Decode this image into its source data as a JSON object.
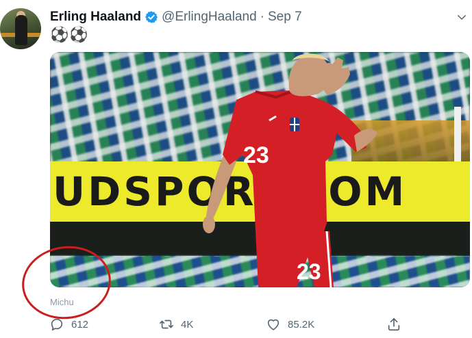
{
  "tweet": {
    "display_name": "Erling Haaland",
    "handle": "@ErlingHaaland",
    "separator": "·",
    "date": "Sep 7",
    "text": "⚽⚽",
    "more_icon": "chevron-down-icon"
  },
  "photo": {
    "banner_text": "UDSPORT.COM",
    "shirt_number": "23",
    "shorts_number": "23",
    "shirt_color": "#d41f26",
    "banner_color": "#ecea2a"
  },
  "annotation": {
    "watermark_text": "Michu",
    "circle_color": "#cc1d1d"
  },
  "actions": {
    "reply_count": "612",
    "retweet_count": "4K",
    "like_count": "85.2K"
  },
  "colors": {
    "verified": "#1d9bf0",
    "secondary_text": "#536471"
  }
}
